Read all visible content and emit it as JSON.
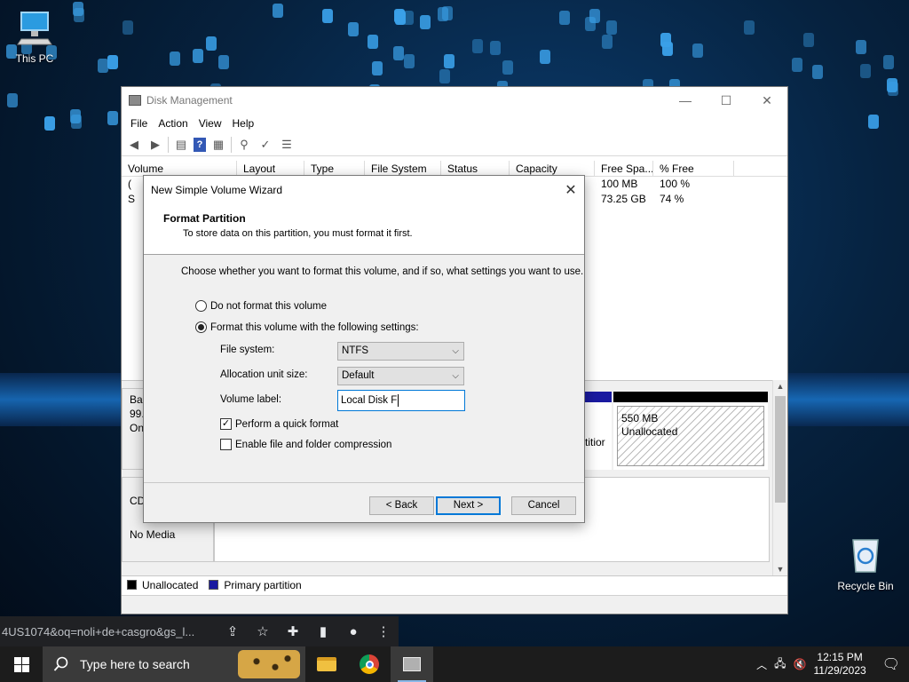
{
  "desktop": {
    "icons": [
      {
        "label": "This PC",
        "icon": "computer-icon"
      },
      {
        "label": "Recycle Bin",
        "icon": "recycle-bin-icon"
      }
    ]
  },
  "window": {
    "title": "Disk Management",
    "controls": {
      "minimize": "—",
      "maximize": "☐",
      "close": "✕"
    },
    "menu": [
      "File",
      "Action",
      "View",
      "Help"
    ],
    "toolbar_icons": [
      "back-arrow-icon",
      "forward-arrow-icon",
      "properties-icon",
      "help-icon",
      "console-icon",
      "connect-icon",
      "check-icon",
      "list-icon"
    ],
    "table": {
      "columns": [
        "Volume",
        "Layout",
        "Type",
        "File System",
        "Status",
        "Capacity",
        "Free Spa...",
        "% Free"
      ],
      "rows": [
        {
          "volume": "(",
          "free": "100 MB",
          "pct": "100 %"
        },
        {
          "volume": "S",
          "free": "73.25 GB",
          "pct": "74 %"
        }
      ]
    },
    "disks": {
      "disk0_lines": [
        "Ba",
        "99.",
        "On"
      ],
      "disk0_partition_fragment": "titior",
      "unallocated_size": "550 MB",
      "unallocated_label": "Unallocated",
      "cd_label": "CD",
      "cd_media": "No Media"
    },
    "legend": {
      "unallocated": "Unallocated",
      "primary": "Primary partition"
    },
    "colors": {
      "unallocated": "#000000",
      "primary": "#1a1aa0"
    }
  },
  "wizard": {
    "title": "New Simple Volume Wizard",
    "close": "✕",
    "heading": "Format Partition",
    "subheading": "To store data on this partition, you must format it first.",
    "intro": "Choose whether you want to format this volume, and if so, what settings you want to use.",
    "radio_no_format": "Do not format this volume",
    "radio_format": "Format this volume with the following settings:",
    "file_system_label": "File system:",
    "file_system_value": "NTFS",
    "alloc_label": "Allocation unit size:",
    "alloc_value": "Default",
    "volume_label_label": "Volume label:",
    "volume_label_value": "Local Disk F",
    "quick_format": "Perform a quick format",
    "compression": "Enable file and folder compression",
    "back": "< Back",
    "next": "Next >",
    "cancel": "Cancel"
  },
  "browser": {
    "url_fragment": "4US1074&oq=noli+de+casgro&gs_l..."
  },
  "taskbar": {
    "search_placeholder": "Type here to search",
    "time": "12:15 PM",
    "date": "11/29/2023"
  }
}
